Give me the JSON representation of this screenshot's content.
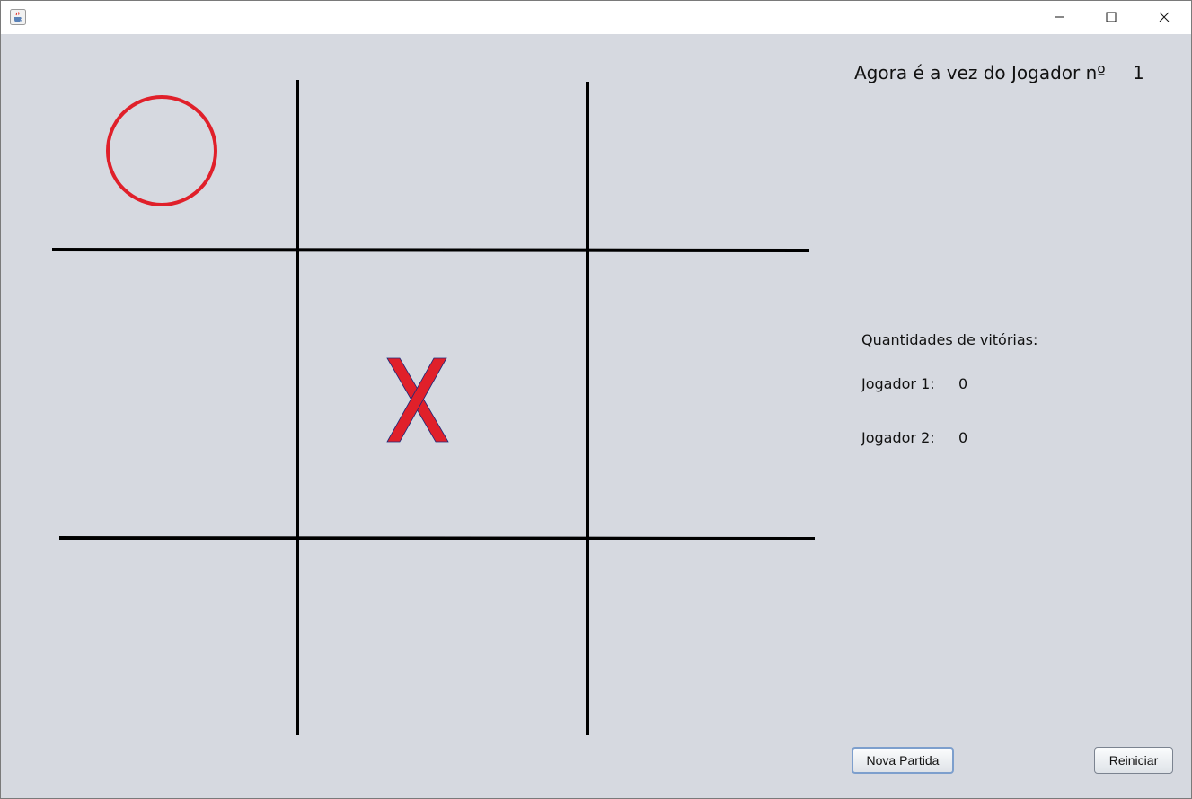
{
  "window": {
    "title": "",
    "icon": "java-coffee-cup-icon",
    "controls": {
      "minimize": "minimize-icon",
      "maximize": "maximize-icon",
      "close": "close-icon"
    }
  },
  "board": {
    "rows": [
      [
        "O",
        "",
        ""
      ],
      [
        "",
        "X",
        ""
      ],
      [
        "",
        "",
        ""
      ]
    ],
    "line_color": "#000000",
    "mark_color": "#e0202a"
  },
  "status": {
    "turn_label": "Agora é a vez do Jogador nº",
    "turn_player": "1"
  },
  "scores": {
    "title": "Quantidades de vitórias:",
    "players": [
      {
        "label": "Jogador 1:",
        "wins": "0"
      },
      {
        "label": "Jogador 2:",
        "wins": "0"
      }
    ]
  },
  "buttons": {
    "new_game": "Nova Partida",
    "restart": "Reiniciar"
  },
  "colors": {
    "background": "#d6d9e0",
    "titlebar": "#ffffff",
    "focus_border": "#7d9fcd"
  }
}
